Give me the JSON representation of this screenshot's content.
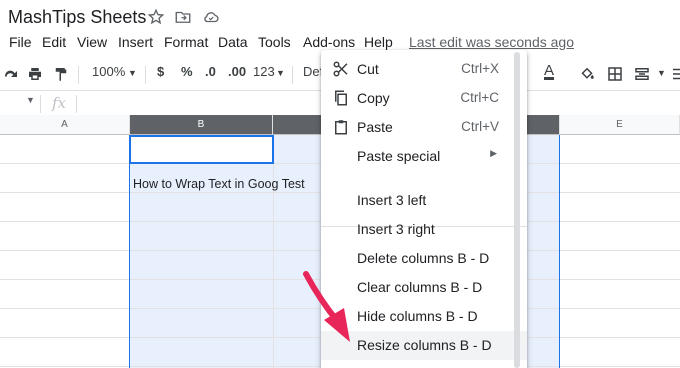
{
  "app": {
    "doc_title": "MashTips Sheets",
    "icons": [
      "star-icon",
      "move-to-folder-icon",
      "cloud-status-icon"
    ]
  },
  "menubar": {
    "items": [
      "File",
      "Edit",
      "View",
      "Insert",
      "Format",
      "Data",
      "Tools",
      "Add-ons",
      "Help"
    ],
    "last_edit": "Last edit was seconds ago"
  },
  "toolbar": {
    "zoom": "100%",
    "currency": "$",
    "percent": "%",
    "decrease_decimal": ".0",
    "increase_decimal": ".00",
    "more_formats": "123",
    "font": "Def",
    "text_color_glyph": "A"
  },
  "formula_bar": {
    "fx": "fx"
  },
  "grid": {
    "columns": [
      "A",
      "B",
      "E"
    ],
    "cell_b3_text": "How to Wrap Text in Goog Test"
  },
  "context_menu": {
    "items": [
      {
        "label": "Cut",
        "shortcut": "Ctrl+X",
        "icon": "scissors-icon"
      },
      {
        "label": "Copy",
        "shortcut": "Ctrl+C",
        "icon": "copy-icon"
      },
      {
        "label": "Paste",
        "shortcut": "Ctrl+V",
        "icon": "clipboard-icon"
      },
      {
        "label": "Paste special",
        "submenu": true
      },
      {
        "label": "Insert 3 left"
      },
      {
        "label": "Insert 3 right"
      },
      {
        "label": "Delete columns B - D"
      },
      {
        "label": "Clear columns B - D"
      },
      {
        "label": "Hide columns B - D"
      },
      {
        "label": "Resize columns B - D",
        "highlighted": true
      }
    ]
  },
  "colors": {
    "selection_fill": "#e8f0fe",
    "selection_border": "#1a73e8",
    "header_selected": "#5f6368",
    "annotation_arrow": "#e8265a"
  }
}
